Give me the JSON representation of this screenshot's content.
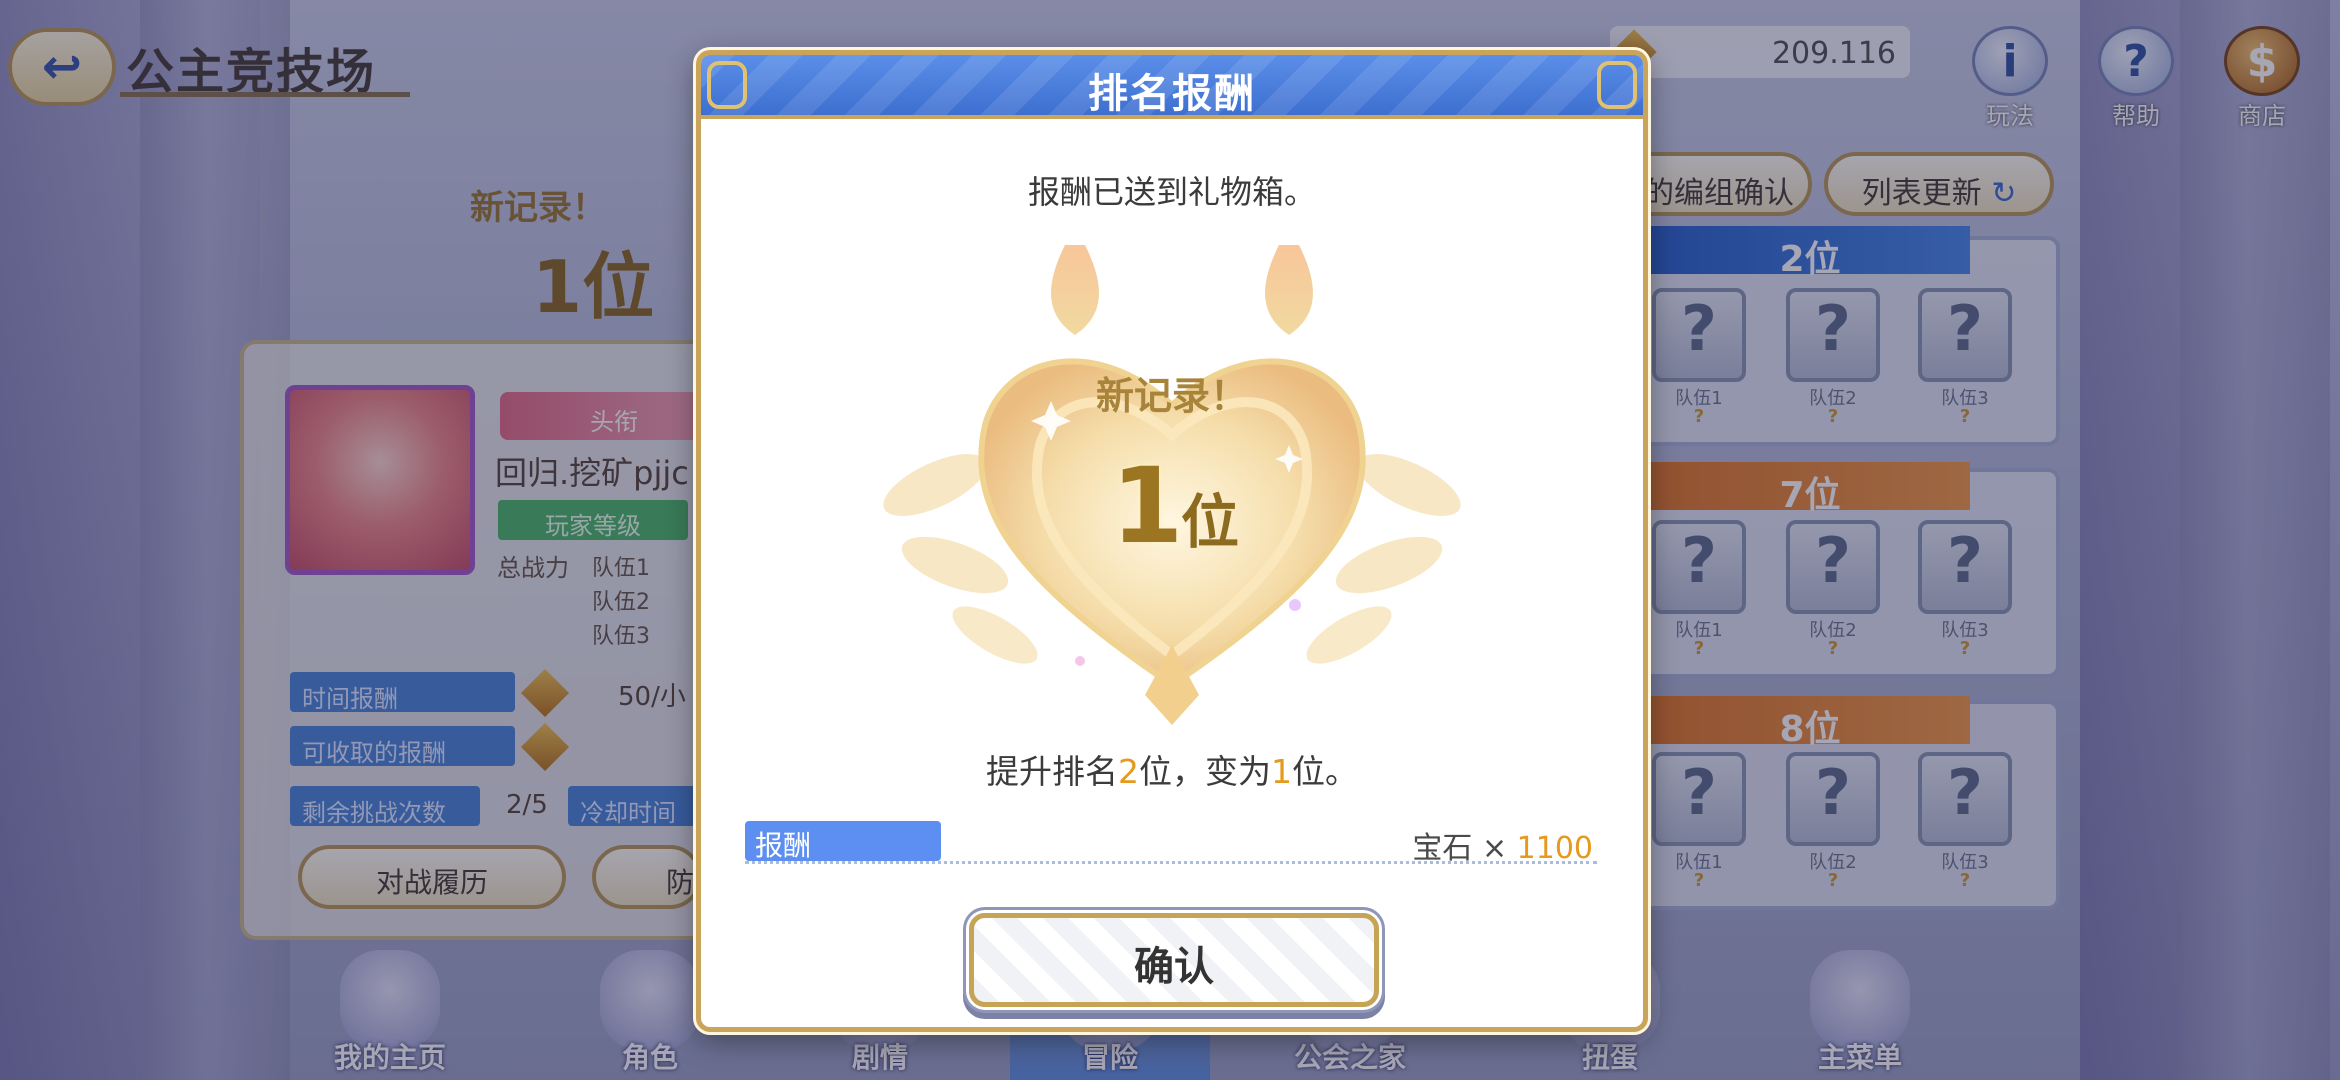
{
  "header": {
    "title": "公主竞技场",
    "currency_value": "209.116"
  },
  "top_icons": [
    {
      "name": "info",
      "glyph": "i",
      "label": "玩法"
    },
    {
      "name": "help",
      "glyph": "?",
      "label": "帮助"
    },
    {
      "name": "shop",
      "glyph": "$",
      "label": "商店"
    }
  ],
  "left_panel": {
    "record_label": "新记录！",
    "record_rank": "1位",
    "player_tag": "头衔",
    "player_name": "回归.挖矿pjjc",
    "player_level": "玩家等级",
    "total_power_label": "总战力",
    "teams": [
      "队伍1",
      "队伍2",
      "队伍3"
    ],
    "time_reward_label": "时间报酬",
    "time_reward_value": "50/小",
    "claimable_label": "可收取的报酬",
    "remaining_label": "剩余挑战次数",
    "remaining_value": "2/5",
    "cooldown_label": "冷却时间",
    "battle_history_btn": "对战履历",
    "defense_btn": "防"
  },
  "right_panel": {
    "confirm_formation_btn": "的编组确认",
    "refresh_btn": "列表更新",
    "opponents": [
      {
        "rank": "2位",
        "slots": [
          "队伍1",
          "队伍2",
          "队伍3"
        ],
        "q": "?"
      },
      {
        "rank": "7位",
        "slots": [
          "队伍1",
          "队伍2",
          "队伍3"
        ],
        "q": "?"
      },
      {
        "rank": "8位",
        "slots": [
          "队伍1",
          "队伍2",
          "队伍3"
        ],
        "q": "?"
      }
    ]
  },
  "bottom_nav": [
    {
      "label": "我的主页",
      "active": false
    },
    {
      "label": "角色",
      "active": false
    },
    {
      "label": "剧情",
      "active": false
    },
    {
      "label": "冒险",
      "active": true
    },
    {
      "label": "公会之家",
      "active": false
    },
    {
      "label": "扭蛋",
      "active": false
    },
    {
      "label": "主菜单",
      "active": false
    }
  ],
  "modal": {
    "title": "排名报酬",
    "message": "报酬已送到礼物箱。",
    "record_text": "新记录！",
    "rank_number": "1",
    "rank_unit": "位",
    "rank_change_pre": "提升排名",
    "rank_change_amount": "2",
    "rank_change_mid": "位，变为",
    "rank_change_new": "1",
    "rank_change_post": "位。",
    "reward_label": "报酬",
    "reward_item": "宝石 × ",
    "reward_amount": "1100",
    "confirm_label": "确认"
  },
  "colors": {
    "accent_blue": "#3d6fd0",
    "gold": "#c9a45a",
    "highlight": "#e59a1d"
  }
}
